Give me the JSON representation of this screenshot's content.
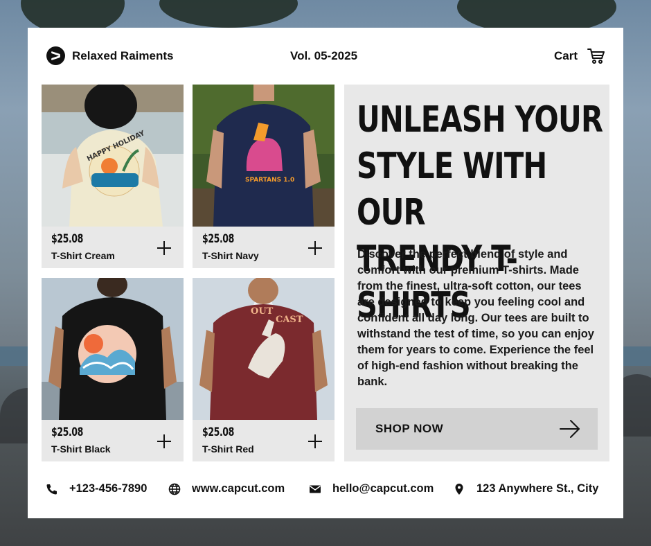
{
  "header": {
    "brand_name": "Relaxed Raiments",
    "volume": "Vol. 05-2025",
    "cart_label": "Cart"
  },
  "products": [
    {
      "price": "$25.08",
      "name": "T-Shirt Cream",
      "shirt_color": "#efe9cf",
      "print": "HAPPY HOLIDAY"
    },
    {
      "price": "$25.08",
      "name": "T-Shirt Navy",
      "shirt_color": "#1f2a4e",
      "print": "SPARTANS 1.0"
    },
    {
      "price": "$25.08",
      "name": "T-Shirt Black",
      "shirt_color": "#151515"
    },
    {
      "price": "$25.08",
      "name": "T-Shirt Red",
      "shirt_color": "#7b2a2e",
      "print": "OUT CAST"
    }
  ],
  "promo": {
    "headline_1": "UNLEASH YOUR",
    "headline_2": "STYLE WITH OUR",
    "headline_3": "TRENDY T-SHIRTS",
    "description": "Discover the perfect blend of style and comfort with our premium T-shirts. Made from the finest, ultra-soft cotton, our tees are designed to keep you feeling cool and confident all day long. Our tees are built to withstand the test of time, so you can enjoy them for years to come. Experience the feel of high-end fashion without breaking the bank.",
    "cta_label": "SHOP NOW"
  },
  "footer": {
    "phone": "+123-456-7890",
    "website": "www.capcut.com",
    "email": "hello@capcut.com",
    "address": "123 Anywhere St., City"
  },
  "colors": {
    "card": "#ffffff",
    "panel": "#e8e8e8",
    "button": "#d2d2d2",
    "text": "#111111"
  },
  "icons": [
    "brand-logo-icon",
    "cart-icon",
    "plus-icon",
    "arrow-right-icon",
    "phone-icon",
    "globe-icon",
    "mail-icon",
    "location-pin-icon"
  ]
}
